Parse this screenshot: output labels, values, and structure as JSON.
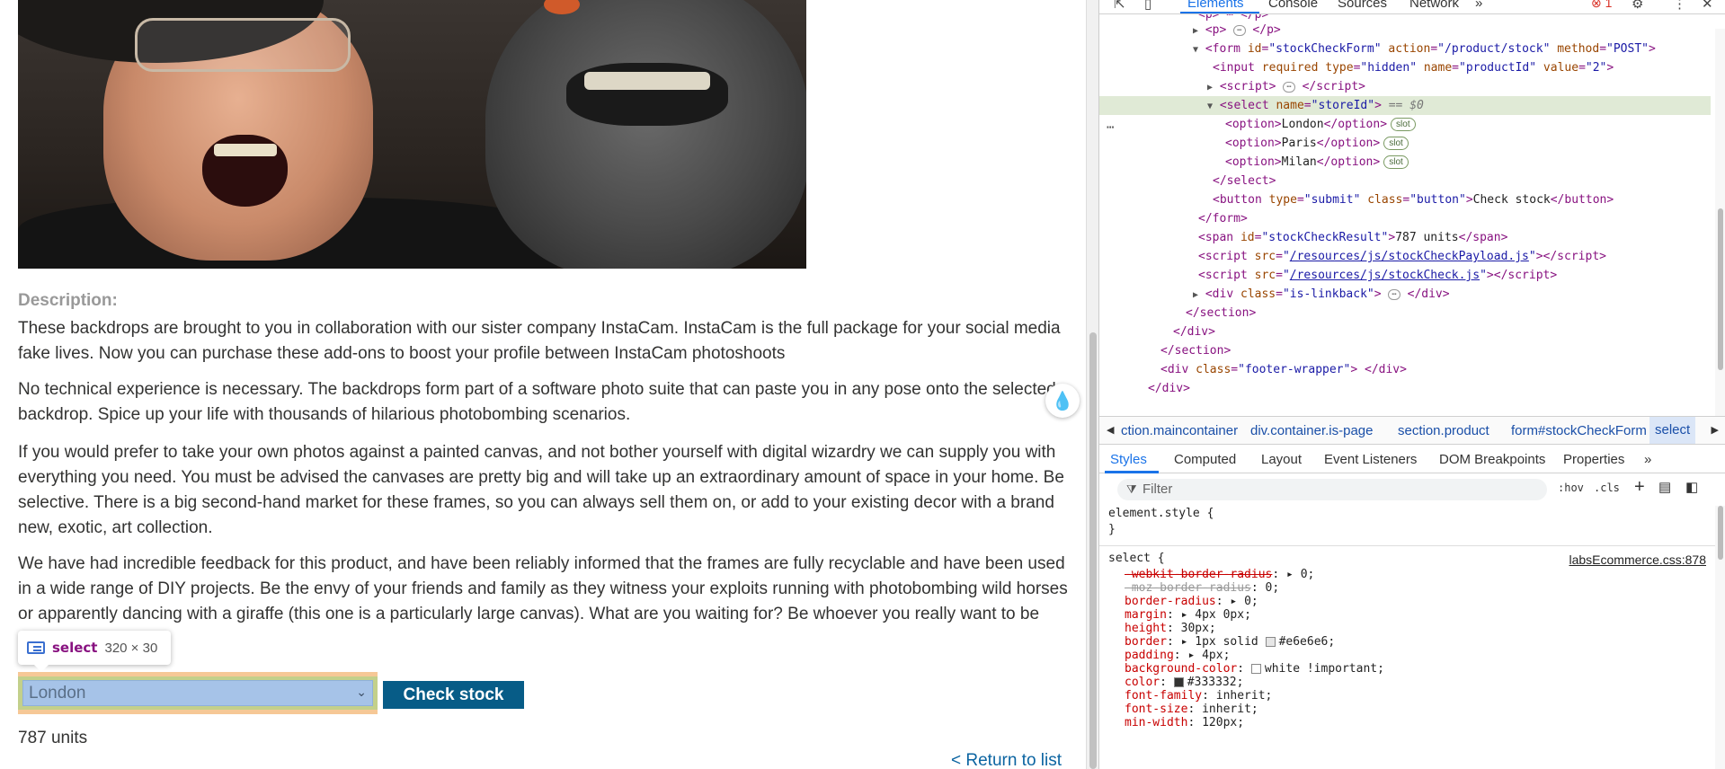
{
  "page": {
    "description_label": "Description:",
    "paragraphs": [
      "These backdrops are brought to you in collaboration with our sister company InstaCam. InstaCam is the full package for your social media fake lives. Now you can purchase these add-ons to boost your profile between InstaCam photoshoots",
      "No technical experience is necessary. The backdrops form part of a software photo suite that can paste you in any pose onto the selected backdrop. Spice up your life with thousands of hilarious photobombing scenarios.",
      "If you would prefer to take your own photos against a painted canvas, and not bother yourself with digital wizardry we can supply you with everything you need. You must be advised the canvases are pretty big and will take up an extraordinary amount of space in your home. Be selective. There is a big second-hand market for these frames, so you can always sell them on, or add to your existing decor with a brand new, exotic, art collection.",
      "We have had incredible feedback for this product, and have been reliably informed that the frames are fully recyclable and have been used in a wide range of DIY projects. Be the envy of your friends and family as they witness your exploits running with photobombing wild horses or apparently dancing with a giraffe (this one is a particularly large canvas). What are you waiting for? Be whoever you really want to be today!"
    ],
    "tooltip": {
      "tag": "select",
      "size": "320 × 30"
    },
    "store_select": {
      "value": "London",
      "options": [
        "London",
        "Paris",
        "Milan"
      ]
    },
    "check_button": "Check stock",
    "stock_result": "787 units",
    "return_link": "< Return to list"
  },
  "devtools": {
    "tabs": [
      "Elements",
      "Console",
      "Sources",
      "Network",
      "»"
    ],
    "error_count": "1",
    "dom": {
      "form_open": {
        "id": "stockCheckForm",
        "action": "/product/stock",
        "method": "POST"
      },
      "input": {
        "required": "required",
        "type": "hidden",
        "name": "productId",
        "value": "2"
      },
      "select_name": "storeId",
      "eq_dollar": "== $0",
      "options": [
        "London",
        "Paris",
        "Milan"
      ],
      "slot_label": "slot",
      "button": {
        "type": "submit",
        "class": "button",
        "text": "Check stock"
      },
      "span": {
        "id": "stockCheckResult",
        "text": "787 units"
      },
      "script1": "/resources/js/stockCheckPayload.js",
      "script2": "/resources/js/stockCheck.js",
      "div_class": "is-linkback",
      "footer_class": "footer-wrapper"
    },
    "breadcrumbs": [
      "ction.maincontainer",
      "div.container.is-page",
      "section.product",
      "form#stockCheckForm",
      "select"
    ],
    "style_tabs": [
      "Styles",
      "Computed",
      "Layout",
      "Event Listeners",
      "DOM Breakpoints",
      "Properties",
      "»"
    ],
    "filter_placeholder": "Filter",
    "hov": ":hov",
    "cls": ".cls",
    "element_style": "element.style {",
    "rule_selector": "select {",
    "rule_source": "labsEcommerce.css:878",
    "declarations": [
      {
        "prop": "-webkit-border-radius",
        "value": "0;",
        "state": "strike"
      },
      {
        "prop": "-moz-border-radius",
        "value": "0;",
        "state": "dim"
      },
      {
        "prop": "border-radius",
        "value": "0;",
        "state": "normal"
      },
      {
        "prop": "margin",
        "value": "4px 0px;",
        "state": "normal"
      },
      {
        "prop": "height",
        "value": "30px;",
        "state": "normal"
      },
      {
        "prop": "border",
        "value": "1px solid #e6e6e6;",
        "state": "normal"
      },
      {
        "prop": "padding",
        "value": "4px;",
        "state": "normal"
      },
      {
        "prop": "background-color",
        "value": "white !important;",
        "state": "normal"
      },
      {
        "prop": "color",
        "value": "#333332;",
        "state": "normal"
      },
      {
        "prop": "font-family",
        "value": "inherit;",
        "state": "normal"
      },
      {
        "prop": "font-size",
        "value": "inherit;",
        "state": "normal"
      },
      {
        "prop": "min-width",
        "value": "120px;",
        "state": "normal"
      }
    ],
    "colors": {
      "accent": "#1a73e8",
      "button": "#075c87",
      "link": "#0b64a1"
    }
  }
}
